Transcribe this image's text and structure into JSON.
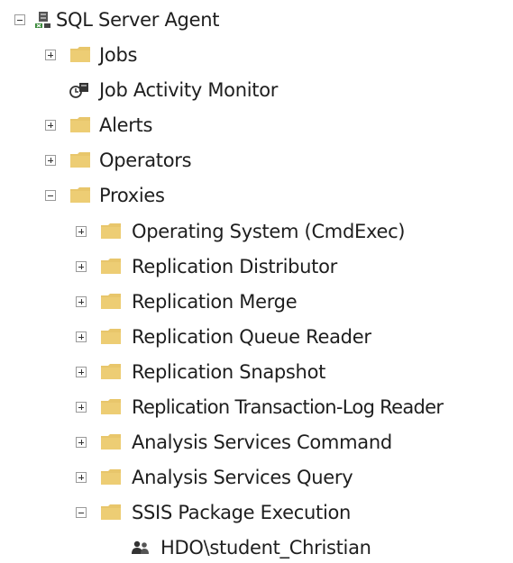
{
  "tree": {
    "root": {
      "label": "SQL Server Agent",
      "icon": "sql-server-agent-icon",
      "expanded": true
    },
    "items": [
      {
        "label": "Jobs",
        "icon": "folder-icon",
        "expanded": false
      },
      {
        "label": "Job Activity Monitor",
        "icon": "job-activity-monitor-icon"
      },
      {
        "label": "Alerts",
        "icon": "folder-icon",
        "expanded": false
      },
      {
        "label": "Operators",
        "icon": "folder-icon",
        "expanded": false
      },
      {
        "label": "Proxies",
        "icon": "folder-icon",
        "expanded": true
      }
    ],
    "proxies": [
      {
        "label": "Operating System (CmdExec)",
        "expanded": false
      },
      {
        "label": "Replication Distributor",
        "expanded": false
      },
      {
        "label": "Replication Merge",
        "expanded": false
      },
      {
        "label": "Replication Queue Reader",
        "expanded": false
      },
      {
        "label": "Replication Snapshot",
        "expanded": false
      },
      {
        "label": "Replication Transaction-Log Reader",
        "expanded": false
      },
      {
        "label": "Analysis Services Command",
        "expanded": false
      },
      {
        "label": "Analysis Services Query",
        "expanded": false
      },
      {
        "label": "SSIS Package Execution",
        "expanded": true
      }
    ],
    "ssis_children": [
      {
        "label": "HDO\\student_Christian",
        "icon": "user-group-icon"
      }
    ]
  },
  "colors": {
    "folder": "#e8c66b",
    "folder_dark": "#d9b45a",
    "text": "#1e1e1e",
    "expander_border": "#9a9a9a"
  }
}
